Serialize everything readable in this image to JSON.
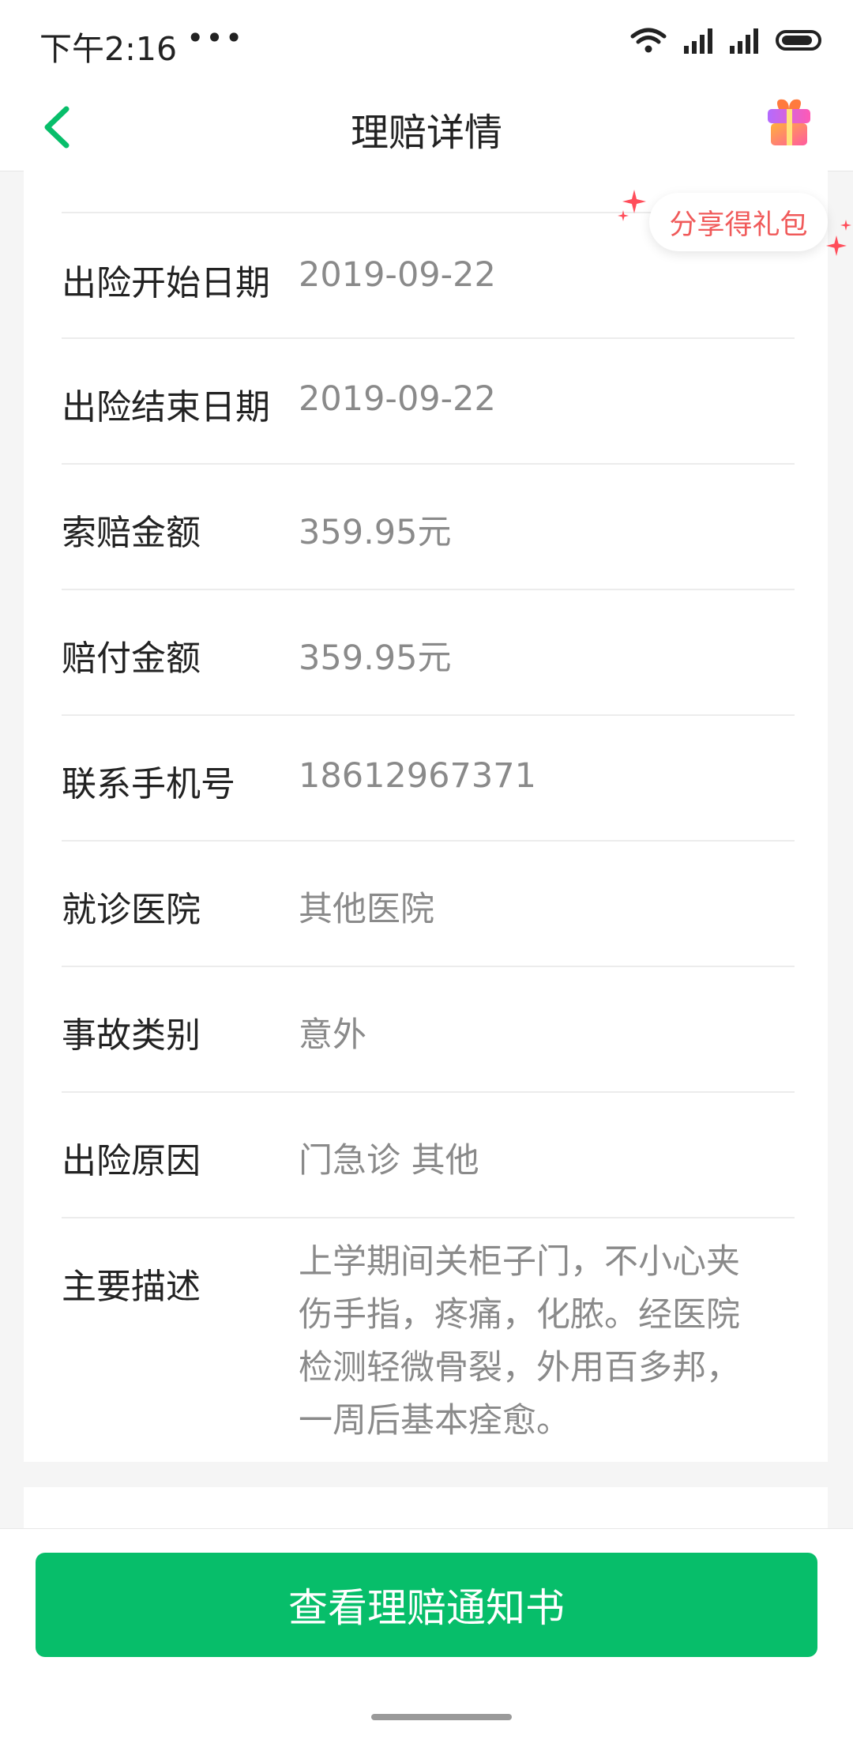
{
  "status_bar": {
    "time": "下午2:16",
    "dots": "•••"
  },
  "nav": {
    "title": "理赔详情"
  },
  "share": {
    "label": "分享得礼包"
  },
  "details": [
    {
      "label": "出险开始日期",
      "value": "2019-09-22"
    },
    {
      "label": "出险结束日期",
      "value": "2019-09-22"
    },
    {
      "label": "索赔金额",
      "value": "359.95元"
    },
    {
      "label": "赔付金额",
      "value": "359.95元"
    },
    {
      "label": "联系手机号",
      "value": "18612967371"
    },
    {
      "label": "就诊医院",
      "value": "其他医院"
    },
    {
      "label": "事故类别",
      "value": "意外"
    },
    {
      "label": "出险原因",
      "value": "门急诊 其他"
    },
    {
      "label": "主要描述",
      "value": "上学期间关柜子门，不小心夹伤手指，疼痛，化脓。经医院检测轻微骨裂，外用百多邦，一周后基本痊愈。"
    }
  ],
  "actions": {
    "view_notice": "查看理赔通知书"
  },
  "colors": {
    "accent": "#07be6a",
    "share_text": "#f05a5a",
    "value_text": "#8a8a8a"
  }
}
